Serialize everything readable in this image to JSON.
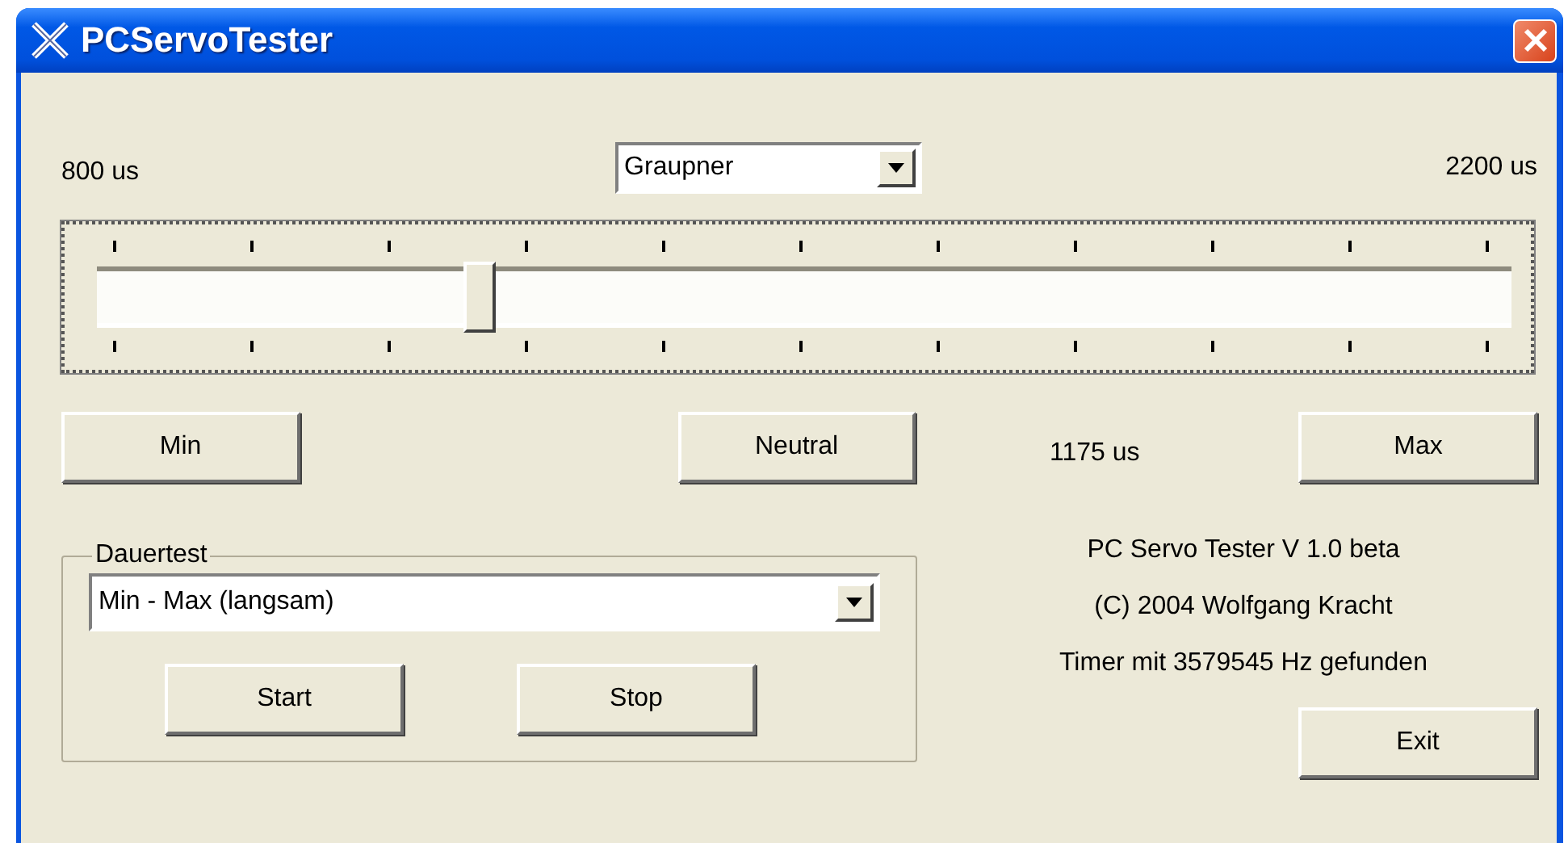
{
  "window": {
    "title": "PCServoTester"
  },
  "range": {
    "min_label": "800 us",
    "max_label": "2200 us"
  },
  "servo_type": {
    "value": "Graupner"
  },
  "slider": {
    "level": 0.27
  },
  "buttons": {
    "min": "Min",
    "neutral": "Neutral",
    "max": "Max",
    "exit": "Exit"
  },
  "reading": "1175 us",
  "dauertest": {
    "label": "Dauertest",
    "mode": "Min - Max (langsam)",
    "start": "Start",
    "stop": "Stop"
  },
  "info": [
    "PC Servo Tester V 1.0 beta",
    "(C) 2004  Wolfgang Kracht",
    "Timer mit 3579545 Hz gefunden"
  ]
}
